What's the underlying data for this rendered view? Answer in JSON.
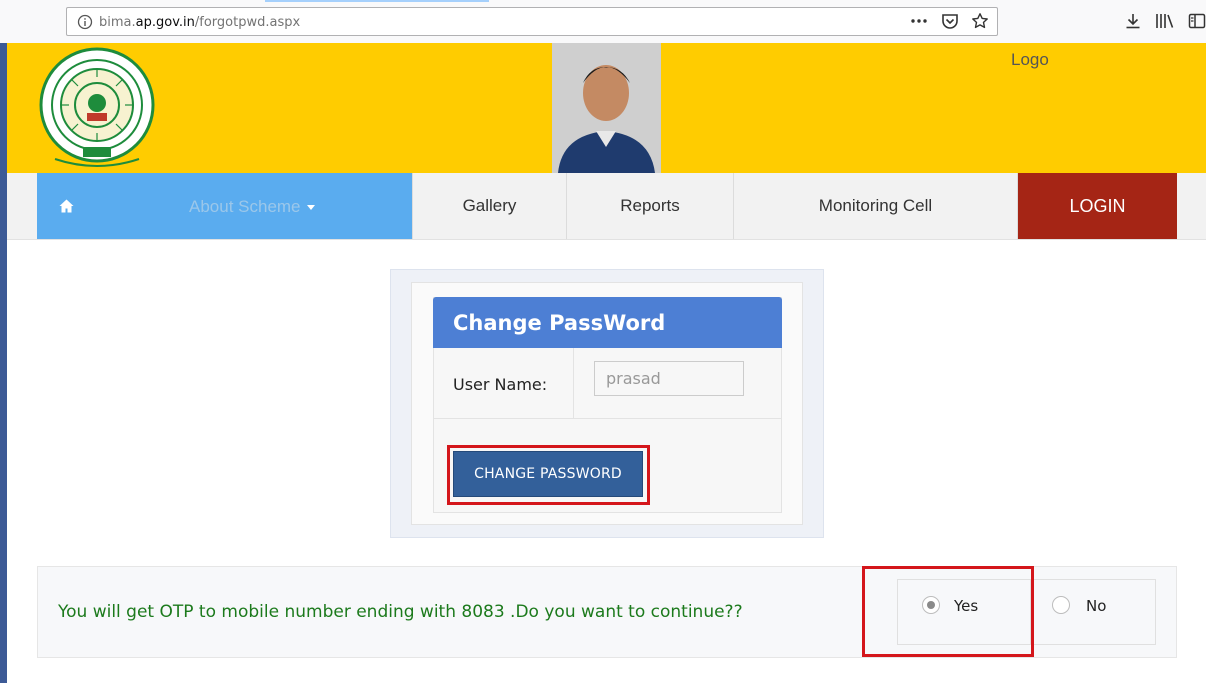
{
  "browser": {
    "url_prefix": "bima.",
    "url_host": "ap.gov.in",
    "url_path": "/forgotpwd.aspx"
  },
  "header": {
    "logo_text": "Logo"
  },
  "nav": {
    "about_label": "About Scheme",
    "gallery_label": "Gallery",
    "reports_label": "Reports",
    "monitoring_label": "Monitoring Cell",
    "login_label": "LOGIN"
  },
  "form": {
    "title": "Change PassWord",
    "username_label": "User Name:",
    "username_value": "prasad",
    "submit_label": "CHANGE PASSWORD"
  },
  "otp": {
    "message": "You will get OTP to mobile number ending with 8083 .Do you want to continue??",
    "options": [
      {
        "label": "Yes",
        "selected": true
      },
      {
        "label": "No",
        "selected": false
      }
    ]
  },
  "colors": {
    "header_bg": "#ffcc00",
    "nav_active": "#5aacef",
    "login_bg": "#a52515",
    "panel_head": "#4d7fd4",
    "button_bg": "#33609a",
    "highlight": "#d4161b",
    "otp_text": "#1c7a1c"
  }
}
